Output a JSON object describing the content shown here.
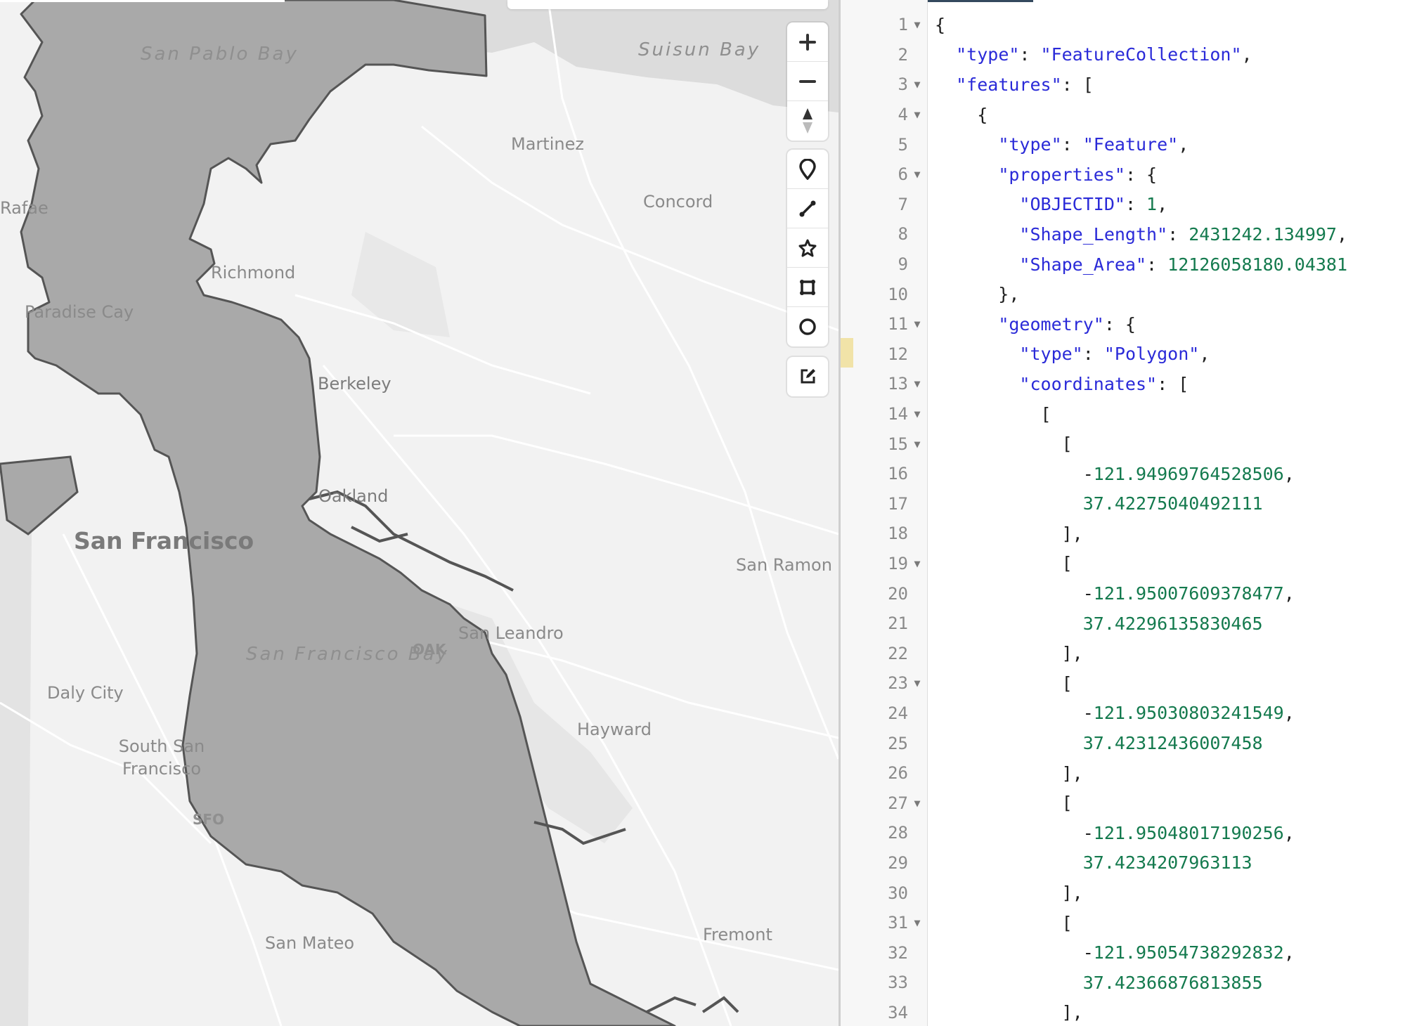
{
  "map": {
    "labels": {
      "san_pablo_bay": "San Pablo Bay",
      "suisun_bay": "Suisun Bay",
      "martinez": "Martinez",
      "concord": "Concord",
      "rafael": "Rafae",
      "richmond": "Richmond",
      "paradise_cay": "Paradise Cay",
      "berkeley": "Berkeley",
      "oakland": "Oakland",
      "san_francisco": "San Francisco",
      "san_ramon": "San Ramon",
      "san_leandro": "San Leandro",
      "oak": "OAK",
      "sf_bay": "San Francisco Bay",
      "daly_city": "Daly City",
      "hayward": "Hayward",
      "south_sf": "South San Francisco",
      "sfo": "SFO",
      "san_mateo": "San Mateo",
      "fremont": "Fremont"
    },
    "controls": {
      "zoom_in_icon": "plus-icon",
      "zoom_out_icon": "minus-icon",
      "compass_icon": "compass-icon",
      "draw_marker_icon": "map-pin-icon",
      "draw_line_icon": "line-icon",
      "draw_polygon_icon": "polygon-icon",
      "draw_rectangle_icon": "rectangle-icon",
      "draw_circle_icon": "circle-icon",
      "edit_icon": "edit-icon"
    },
    "colors": {
      "land": "#f2f2f2",
      "water_feature": "#a9a9a9",
      "outline": "#555555"
    }
  },
  "editor": {
    "lines": [
      {
        "n": "1",
        "fold": true,
        "html": "{"
      },
      {
        "n": "2",
        "fold": false,
        "html": "  <k>\"type\"</k>: <s>\"FeatureCollection\"</s>,"
      },
      {
        "n": "3",
        "fold": true,
        "html": "  <k>\"features\"</k>: ["
      },
      {
        "n": "4",
        "fold": true,
        "html": "    {"
      },
      {
        "n": "5",
        "fold": false,
        "html": "      <k>\"type\"</k>: <s>\"Feature\"</s>,"
      },
      {
        "n": "6",
        "fold": true,
        "html": "      <k>\"properties\"</k>: {"
      },
      {
        "n": "7",
        "fold": false,
        "html": "        <k>\"OBJECTID\"</k>: <d>1</d>,"
      },
      {
        "n": "8",
        "fold": false,
        "html": "        <k>\"Shape_Length\"</k>: <d>2431242.134997</d>,"
      },
      {
        "n": "9",
        "fold": false,
        "html": "        <k>\"Shape_Area\"</k>: <d>12126058180.04381</d>"
      },
      {
        "n": "10",
        "fold": false,
        "html": "      },"
      },
      {
        "n": "11",
        "fold": true,
        "html": "      <k>\"geometry\"</k>: {"
      },
      {
        "n": "12",
        "fold": false,
        "html": "        <k>\"type\"</k>: <s>\"Polygon\"</s>,"
      },
      {
        "n": "13",
        "fold": true,
        "html": "        <k>\"coordinates\"</k>: ["
      },
      {
        "n": "14",
        "fold": true,
        "html": "          ["
      },
      {
        "n": "15",
        "fold": true,
        "html": "            ["
      },
      {
        "n": "16",
        "fold": false,
        "html": "              -<d>121.94969764528506</d>,"
      },
      {
        "n": "17",
        "fold": false,
        "html": "              <d>37.42275040492111</d>"
      },
      {
        "n": "18",
        "fold": false,
        "html": "            ],"
      },
      {
        "n": "19",
        "fold": true,
        "html": "            ["
      },
      {
        "n": "20",
        "fold": false,
        "html": "              -<d>121.95007609378477</d>,"
      },
      {
        "n": "21",
        "fold": false,
        "html": "              <d>37.42296135830465</d>"
      },
      {
        "n": "22",
        "fold": false,
        "html": "            ],"
      },
      {
        "n": "23",
        "fold": true,
        "html": "            ["
      },
      {
        "n": "24",
        "fold": false,
        "html": "              -<d>121.95030803241549</d>,"
      },
      {
        "n": "25",
        "fold": false,
        "html": "              <d>37.42312436007458</d>"
      },
      {
        "n": "26",
        "fold": false,
        "html": "            ],"
      },
      {
        "n": "27",
        "fold": true,
        "html": "            ["
      },
      {
        "n": "28",
        "fold": false,
        "html": "              -<d>121.95048017190256</d>,"
      },
      {
        "n": "29",
        "fold": false,
        "html": "              <d>37.4234207963113</d>"
      },
      {
        "n": "30",
        "fold": false,
        "html": "            ],"
      },
      {
        "n": "31",
        "fold": true,
        "html": "            ["
      },
      {
        "n": "32",
        "fold": false,
        "html": "              -<d>121.95054738292832</d>,"
      },
      {
        "n": "33",
        "fold": false,
        "html": "              <d>37.42366876813855</d>"
      },
      {
        "n": "34",
        "fold": false,
        "html": "            ],"
      }
    ],
    "fold_glyph": "▼",
    "colors": {
      "key": "#2a2ad8",
      "string": "#2a2ad8",
      "number": "#147a4e",
      "gutter_bg": "#f7f7f7",
      "active_marker": "#f1e3a8"
    }
  }
}
